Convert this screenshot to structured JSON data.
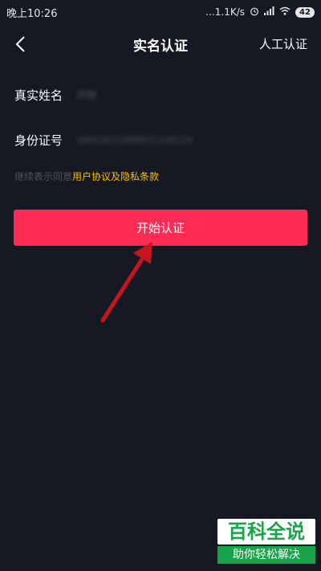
{
  "status_bar": {
    "time": "晚上10:26",
    "speed": "...1.1K/s",
    "battery": "42"
  },
  "nav": {
    "title": "实名认证",
    "right_link": "人工认证"
  },
  "form": {
    "name_label": "真实姓名",
    "name_value": "庐翔",
    "id_label": "身份证号",
    "id_value": "36010219890312452X"
  },
  "agreement": {
    "prefix": "继续表示同意",
    "link": "用户协议及隐私条款"
  },
  "start_button": "开始认证",
  "watermark": {
    "top": "百科全说",
    "bottom": "助你轻松解决"
  },
  "colors": {
    "background": "#161823",
    "primary_button": "#fe2c55",
    "link": "#f5c000",
    "annotation_arrow": "#c4161c"
  },
  "icons": [
    "back-chevron-icon",
    "alarm-icon",
    "signal-icon",
    "wifi-icon",
    "battery-icon"
  ]
}
